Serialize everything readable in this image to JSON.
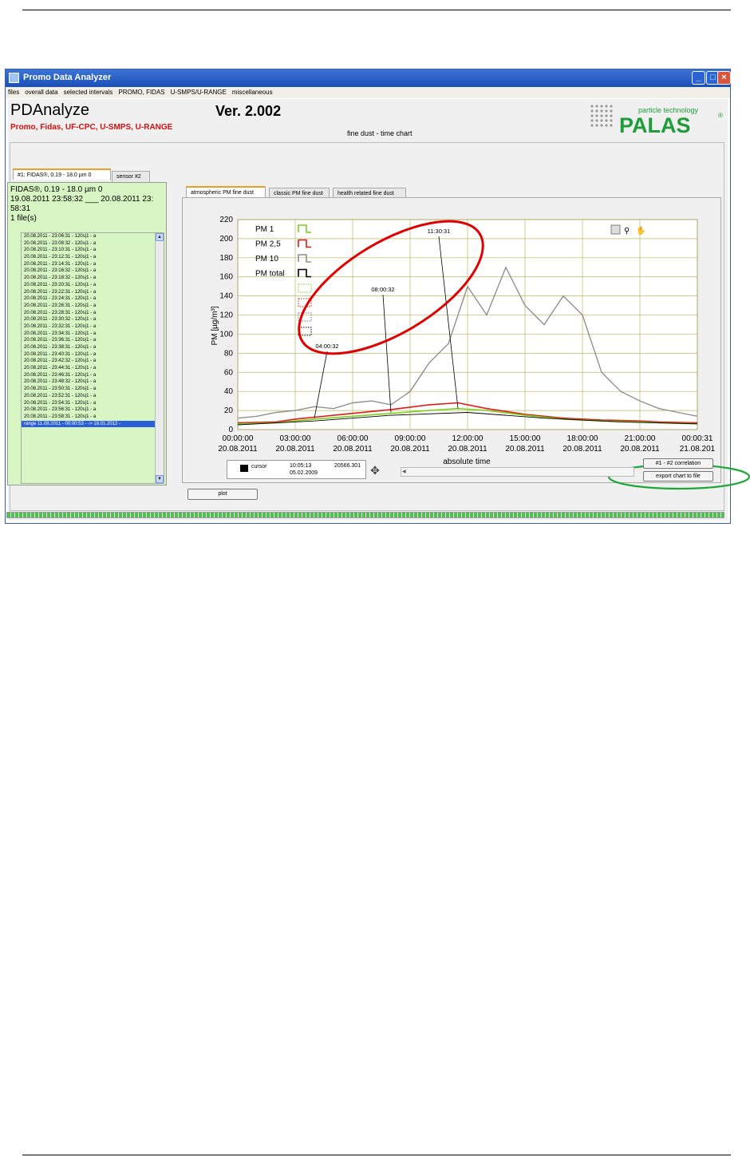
{
  "window": {
    "title": "Promo Data Analyzer",
    "menu": [
      "files",
      "overall data",
      "selected intervals",
      "PROMO, FIDAS",
      "U-SMPS/U-RANGE",
      "miscellaneous"
    ]
  },
  "header": {
    "app_name": "PDAnalyze",
    "version": "Ver. 2.002",
    "subtitle": "Promo, Fidas, UF-CPC, U-SMPS, U-RANGE",
    "chart_title": "fine dust - time chart",
    "logo_tagline": "particle technology",
    "logo_brand": "PALAS",
    "logo_reg": "®"
  },
  "sensor_tabs": [
    "#1: FIDAS®, 0.19 - 18.0 µm 0",
    "sensor #2"
  ],
  "left": {
    "info_lines": [
      "FIDAS®, 0.19 - 18.0 µm 0",
      "19.08.2011 23:58:32 ___ 20.08.2011 23:",
      "58:31",
      "1 file(s)"
    ],
    "files": [
      "20.08.2011 - 23:06:31 - 120s|1 - a",
      "20.08.2011 - 23:08:32 - 120s|1 - a",
      "20.08.2011 - 23:10:31 - 120s|1 - a",
      "20.08.2011 - 23:12:31 - 120s|1 - a",
      "20.08.2011 - 23:14:31 - 120s|1 - a",
      "20.08.2011 - 23:16:32 - 120s|1 - a",
      "20.08.2011 - 23:18:32 - 120s|1 - a",
      "20.08.2011 - 23:20:31 - 120s|1 - a",
      "20.08.2011 - 23:22:31 - 120s|1 - a",
      "20.08.2011 - 23:24:31 - 120s|1 - a",
      "20.08.2011 - 23:26:31 - 120s|1 - a",
      "20.08.2011 - 23:28:31 - 120s|1 - a",
      "20.08.2011 - 23:30:32 - 120s|1 - a",
      "20.08.2011 - 23:32:31 - 120s|1 - a",
      "20.08.2011 - 23:34:31 - 120s|1 - a",
      "20.08.2011 - 23:36:31 - 120s|1 - a",
      "20.08.2011 - 23:38:31 - 120s|1 - a",
      "20.08.2011 - 23:40:31 - 120s|1 - a",
      "20.08.2011 - 23:42:32 - 120s|1 - a",
      "20.08.2011 - 23:44:31 - 120s|1 - a",
      "20.08.2011 - 23:46:31 - 120s|1 - a",
      "20.08.2011 - 23:48:32 - 120s|1 - a",
      "20.08.2011 - 23:50:31 - 120s|1 - a",
      "20.08.2011 - 23:52:31 - 120s|1 - a",
      "20.08.2011 - 23:54:31 - 120s|1 - a",
      "20.08.2011 - 23:56:31 - 120s|1 - a",
      "20.08.2011 - 23:58:31 - 120s|1 - a",
      "range 11.08.2011 - 00:00:53 - -> 18.01.2012 -"
    ],
    "plot_button": "plot"
  },
  "chart_tabs": [
    "atmospheric PM fine dust",
    "classic PM fine dust",
    "health related fine dust"
  ],
  "cursor": {
    "label": "cursor",
    "time": "10:05:13",
    "date": "05.02.2009",
    "value": "20566.301"
  },
  "buttons": {
    "correlation": "#1 - #2 correlation",
    "export": "export chart to file"
  },
  "colors": {
    "pm1": "#7ad11f",
    "pm25": "#e01818",
    "pm10": "#909090",
    "pmtotal": "#000000",
    "grid": "#b8b860",
    "highlight_red": "#e00000",
    "highlight_green": "#1fa83a"
  },
  "chart_data": {
    "type": "line",
    "xlabel": "absolute time",
    "ylabel": "PM [µg/m³]",
    "ylim": [
      0,
      220
    ],
    "y_ticks": [
      0,
      20,
      40,
      60,
      80,
      100,
      120,
      140,
      160,
      180,
      200,
      220
    ],
    "x_ticks": [
      {
        "time": "00:00:00",
        "date": "20.08.2011"
      },
      {
        "time": "03:00:00",
        "date": "20.08.2011"
      },
      {
        "time": "06:00:00",
        "date": "20.08.2011"
      },
      {
        "time": "09:00:00",
        "date": "20.08.2011"
      },
      {
        "time": "12:00:00",
        "date": "20.08.2011"
      },
      {
        "time": "15:00:00",
        "date": "20.08.2011"
      },
      {
        "time": "18:00:00",
        "date": "20.08.2011"
      },
      {
        "time": "21:00:00",
        "date": "20.08.2011"
      },
      {
        "time": "00:00:31",
        "date": "21.08.201"
      }
    ],
    "x_range_hours": [
      0,
      24
    ],
    "grid": true,
    "legend_position": "top-left",
    "legend": [
      "PM 1",
      "PM 2,5",
      "PM 10",
      "PM total"
    ],
    "annotations": [
      {
        "label": "04:00:32",
        "x": 4.0,
        "y": 12
      },
      {
        "label": "08:00:32",
        "x": 8.0,
        "y": 18
      },
      {
        "label": "11:30:31",
        "x": 11.5,
        "y": 22
      }
    ],
    "series": [
      {
        "name": "PM 1",
        "x": [
          0,
          2,
          3,
          4,
          6,
          8,
          10,
          11.5,
          13,
          15,
          17,
          19,
          21,
          22,
          24
        ],
        "values": [
          6,
          7,
          9,
          11,
          14,
          17,
          20,
          22,
          20,
          15,
          11,
          9,
          8,
          7,
          6
        ]
      },
      {
        "name": "PM 2,5",
        "x": [
          0,
          2,
          3,
          4,
          6,
          8,
          10,
          11.5,
          13,
          15,
          17,
          19,
          21,
          22,
          24
        ],
        "values": [
          7,
          8,
          11,
          13,
          17,
          21,
          26,
          28,
          22,
          16,
          12,
          10,
          9,
          8,
          7
        ]
      },
      {
        "name": "PM 10",
        "x": [
          0,
          1,
          2,
          3,
          4,
          5,
          6,
          7,
          8,
          9,
          10,
          11,
          12,
          13,
          14,
          15,
          16,
          17,
          18,
          19,
          20,
          21,
          22,
          23,
          24
        ],
        "values": [
          12,
          14,
          18,
          20,
          24,
          22,
          28,
          30,
          26,
          40,
          70,
          90,
          150,
          120,
          170,
          130,
          110,
          140,
          120,
          60,
          40,
          30,
          22,
          18,
          14
        ]
      },
      {
        "name": "PM total",
        "x": [
          0,
          4,
          8,
          12,
          16,
          20,
          24
        ],
        "values": [
          5,
          9,
          15,
          18,
          12,
          8,
          6
        ]
      }
    ]
  }
}
